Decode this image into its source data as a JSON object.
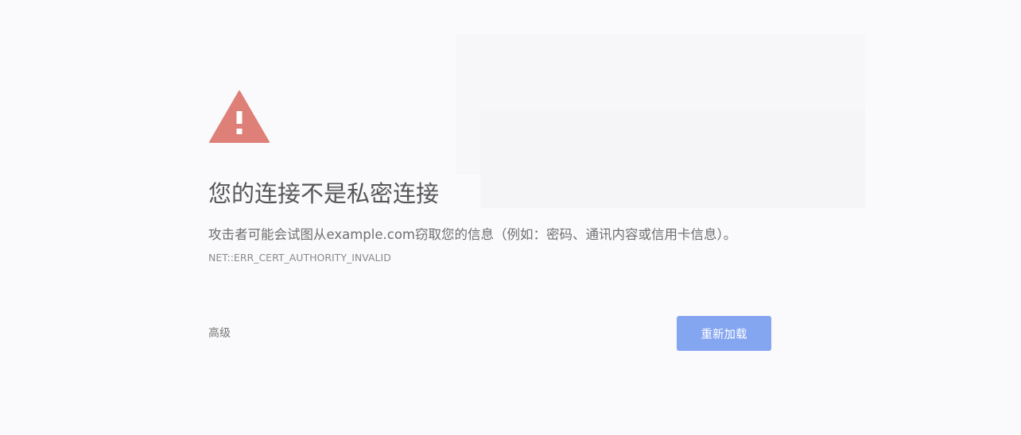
{
  "page": {
    "title": "您的连接不是私密连接",
    "message": "攻击者可能会试图从example.com窃取您的信息（例如：密码、通讯内容或信用卡信息）。",
    "error_code": "NET::ERR_CERT_AUTHORITY_INVALID"
  },
  "actions": {
    "advanced_label": "高级",
    "reload_label": "重新加载"
  },
  "icon": {
    "name": "warning-triangle-icon",
    "color": "#de8077"
  },
  "colors": {
    "background": "#fafafc",
    "title": "#575757",
    "body_text": "#6f6f6f",
    "error_code": "#8a8a8a",
    "button": "#84a5f0",
    "button_text": "#ffffff"
  }
}
